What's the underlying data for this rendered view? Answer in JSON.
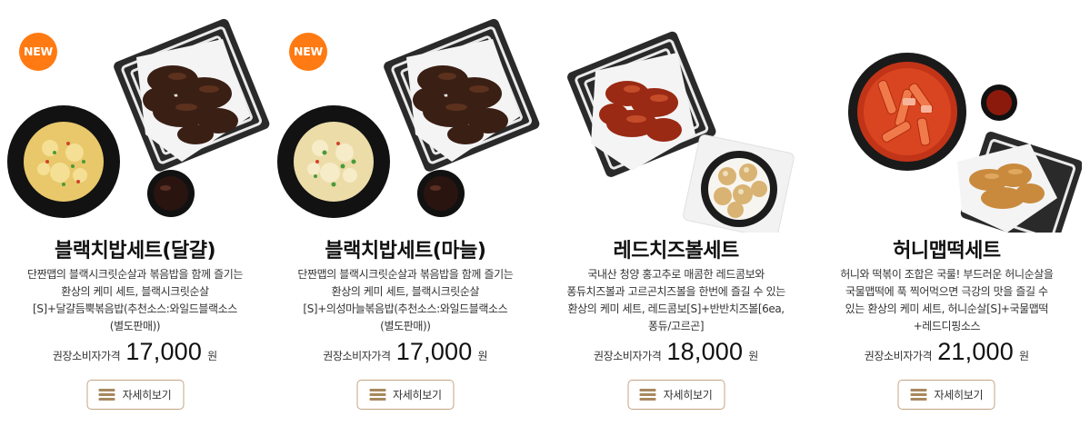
{
  "products": [
    {
      "badge": "NEW",
      "title": "블랙치밥세트(달걀)",
      "desc": [
        "단짠맵의 블랙시크릿순살과 볶음밥을 함께 즐기는",
        "환상의 케미 세트, 블랙시크릿순살",
        "[S]+달걀듬뿍볶음밥(추천소스:와일드블랙소스",
        "(별도판매))"
      ],
      "price_label": "권장소비자가격",
      "price": "17,000",
      "unit": "원",
      "button_label": "자세히보기"
    },
    {
      "badge": "NEW",
      "title": "블랙치밥세트(마늘)",
      "desc": [
        "단짠맵의 블랙시크릿순살과 볶음밥을 함께 즐기는",
        "환상의 케미 세트, 블랙시크릿순살",
        "[S]+의성마늘볶음밥(추천소스:와일드블랙소스",
        "(별도판매))"
      ],
      "price_label": "권장소비자가격",
      "price": "17,000",
      "unit": "원",
      "button_label": "자세히보기"
    },
    {
      "badge": "",
      "title": "레드치즈볼세트",
      "desc": [
        "국내산 청양 홍고추로 매콤한 레드콤보와",
        "퐁듀치즈볼과 고르곤치즈볼을 한번에 즐길 수 있는",
        "환상의 케미 세트, 레드콤보[S]+반반치즈볼[6ea,",
        "퐁듀/고르곤]"
      ],
      "price_label": "권장소비자가격",
      "price": "18,000",
      "unit": "원",
      "button_label": "자세히보기"
    },
    {
      "badge": "",
      "title": "허니맵떡세트",
      "desc": [
        "허니와 떡볶이 조합은 국룰! 부드러운 허니순살을",
        "국물맵떡에 푹 찍어먹으면 극강의 맛을 즐길 수",
        "있는 환상의 케미 세트, 허니순살[S]+국물맵떡",
        "+레드디핑소스"
      ],
      "price_label": "권장소비자가격",
      "price": "21,000",
      "unit": "원",
      "button_label": "자세히보기"
    }
  ],
  "colors": {
    "badge": "#ff7a12",
    "button_border": "#c4a484",
    "menu_icon": "#a8885f"
  }
}
